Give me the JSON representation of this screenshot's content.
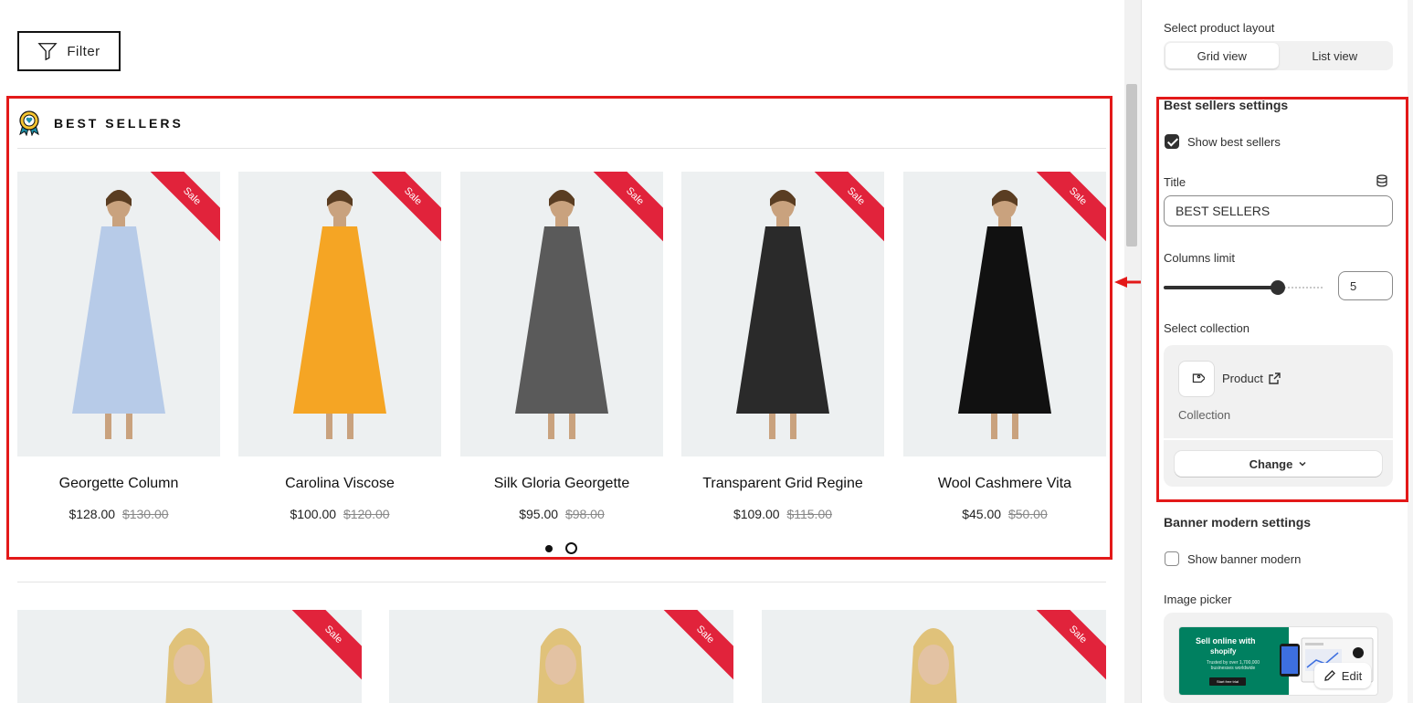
{
  "filter": {
    "label": "Filter"
  },
  "best_sellers": {
    "title": "BEST SELLERS",
    "sale_label": "Sale",
    "products": [
      {
        "name": "Georgette Column",
        "price": "$128.00",
        "old_price": "$130.00",
        "dress_color": "#b7cbe8"
      },
      {
        "name": "Carolina Viscose",
        "price": "$100.00",
        "old_price": "$120.00",
        "dress_color": "#f5a524"
      },
      {
        "name": "Silk Gloria Georgette",
        "price": "$95.00",
        "old_price": "$98.00",
        "dress_color": "#5a5a5a"
      },
      {
        "name": "Transparent Grid Regine",
        "price": "$109.00",
        "old_price": "$115.00",
        "dress_color": "#2a2a2a"
      },
      {
        "name": "Wool Cashmere Vita",
        "price": "$45.00",
        "old_price": "$50.00",
        "dress_color": "#111111"
      }
    ],
    "pagination": {
      "pages": 2,
      "current": 1
    }
  },
  "second_row": {
    "sale_label": "Sale",
    "count": 3
  },
  "colors": {
    "highlight": "#e31919",
    "sale": "#e1233b",
    "shopify_green": "#008060"
  },
  "settings": {
    "layout_label": "Select product layout",
    "layout_options": [
      "Grid view",
      "List view"
    ],
    "layout_selected": "Grid view",
    "best_sellers_heading": "Best sellers settings",
    "show_best_sellers_label": "Show best sellers",
    "show_best_sellers": true,
    "title_label": "Title",
    "title_value": "BEST SELLERS",
    "columns_label": "Columns limit",
    "columns_value": "5",
    "columns_fraction": 0.71,
    "collection_label": "Select collection",
    "collection_name": "Product",
    "collection_sub": "Collection",
    "change_label": "Change",
    "banner_heading": "Banner modern settings",
    "show_banner_label": "Show banner modern",
    "show_banner": false,
    "image_picker_label": "Image picker",
    "banner_line1": "Sell online with",
    "banner_line2": "shopify",
    "banner_line3": "Trusted by over 1,700,000 businesses worldwide",
    "banner_cta": "Start free trial",
    "edit_label": "Edit"
  }
}
